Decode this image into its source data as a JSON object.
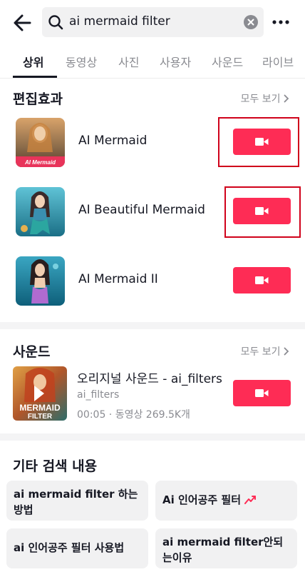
{
  "search": {
    "query": "ai mermaid filter"
  },
  "tabs": [
    {
      "label": "상위"
    },
    {
      "label": "동영상"
    },
    {
      "label": "사진"
    },
    {
      "label": "사용자"
    },
    {
      "label": "사운드"
    },
    {
      "label": "라이브"
    }
  ],
  "effects": {
    "title": "편집효과",
    "see_all": "모두 보기",
    "items": [
      {
        "name": "AI Mermaid",
        "thumb_caption": "AI Mermaid"
      },
      {
        "name": "AI Beautiful Mermaid"
      },
      {
        "name": "AI Mermaid II"
      }
    ]
  },
  "sounds": {
    "title": "사운드",
    "see_all": "모두 보기",
    "item": {
      "title": "오리지널 사운드 - ai_filters",
      "author": "ai_filters",
      "meta": "00:05 · 동영상 269.5K개",
      "thumb_text_1": "MERMAID",
      "thumb_text_2": "FILTER"
    }
  },
  "other_searches": {
    "title": "기타 검색 내용",
    "items": [
      {
        "label": "ai mermaid filter 하는 방법"
      },
      {
        "label": "Ai 인어공주 필터"
      },
      {
        "label": "ai 인어공주 필터 사용법"
      },
      {
        "label": "ai mermaid filter안되는이유"
      }
    ]
  },
  "colors": {
    "accent": "#fe2c55",
    "highlight": "#d0021b",
    "trend": "#fe2c55"
  }
}
